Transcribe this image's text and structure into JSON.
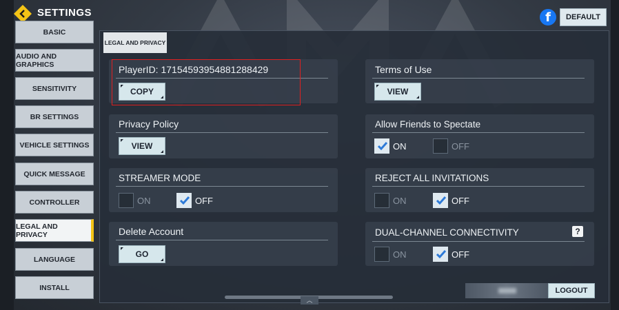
{
  "header": {
    "title": "SETTINGS",
    "default_label": "DEFAULT",
    "facebook_glyph": "f"
  },
  "sidebar": {
    "items": [
      {
        "label": "BASIC",
        "active": false
      },
      {
        "label": "AUDIO AND GRAPHICS",
        "active": false
      },
      {
        "label": "SENSITIVITY",
        "active": false
      },
      {
        "label": "BR SETTINGS",
        "active": false
      },
      {
        "label": "VEHICLE SETTINGS",
        "active": false
      },
      {
        "label": "QUICK MESSAGE",
        "active": false
      },
      {
        "label": "CONTROLLER",
        "active": false
      },
      {
        "label": "LEGAL AND PRIVACY",
        "active": true
      },
      {
        "label": "LANGUAGE",
        "active": false
      },
      {
        "label": "INSTALL",
        "active": false
      }
    ]
  },
  "panel": {
    "tab_label": "LEGAL AND PRIVACY",
    "player_id": {
      "label": "PlayerID: 17154593954881288429",
      "copy_label": "COPY"
    },
    "terms": {
      "label": "Terms of Use",
      "button": "VIEW"
    },
    "privacy": {
      "label": "Privacy Policy",
      "button": "VIEW"
    },
    "spectate": {
      "label": "Allow Friends to Spectate",
      "on_label": "ON",
      "off_label": "OFF",
      "selected": "ON"
    },
    "streamer": {
      "label": "STREAMER MODE",
      "on_label": "ON",
      "off_label": "OFF",
      "selected": "OFF"
    },
    "reject": {
      "label": "REJECT ALL INVITATIONS",
      "on_label": "ON",
      "off_label": "OFF",
      "selected": "OFF"
    },
    "delete_account": {
      "label": "Delete Account",
      "button": "GO"
    },
    "dual_channel": {
      "label": "DUAL-CHANNEL CONNECTIVITY",
      "help_glyph": "?",
      "on_label": "ON",
      "off_label": "OFF",
      "selected": "OFF"
    },
    "logout_label": "LOGOUT",
    "scroll_up_glyph": "︿"
  },
  "colors": {
    "accent_yellow": "#f3c316",
    "highlight_red": "#e02020",
    "button_light": "#d6e7ec",
    "facebook_blue": "#1877f2"
  },
  "icons": [
    "back-arrow-icon",
    "facebook-icon",
    "checkmark-icon",
    "help-icon",
    "chevron-up-icon"
  ]
}
